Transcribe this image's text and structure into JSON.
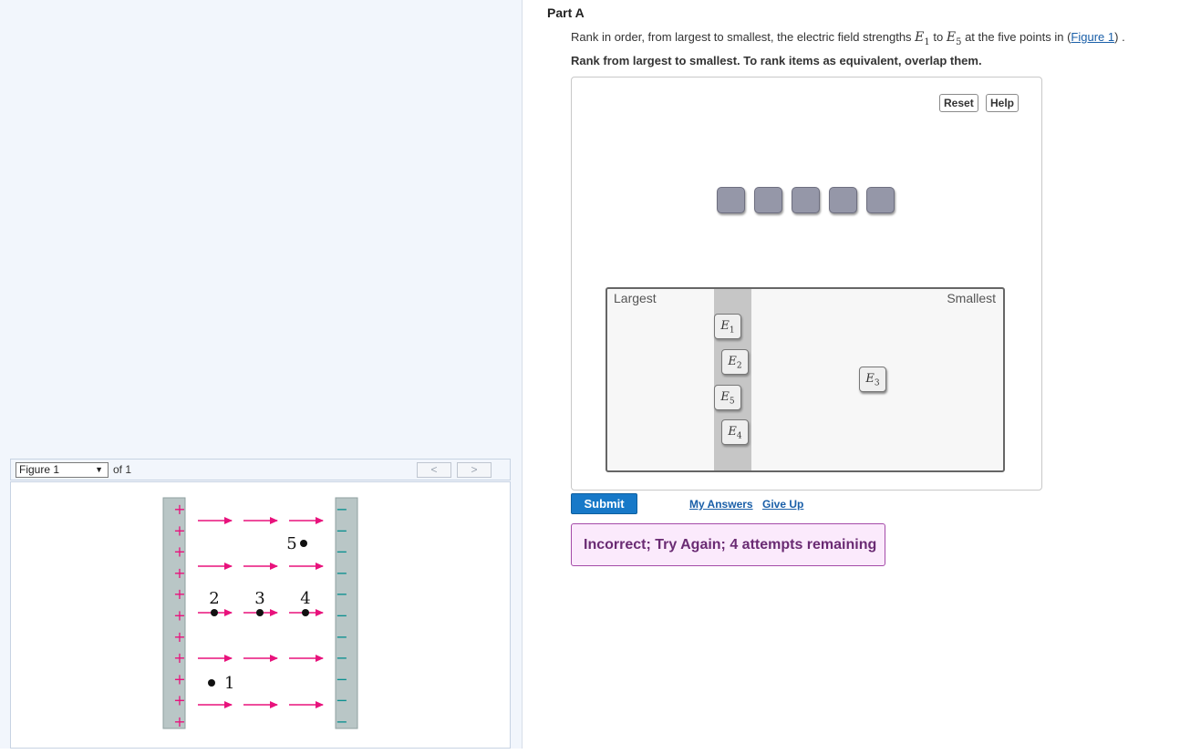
{
  "part": {
    "title": "Part A"
  },
  "question": {
    "prefix": "Rank in order, from largest to smallest, the electric field strengths ",
    "e_from": "E",
    "e_from_sub": "1",
    "mid": " to ",
    "e_to": "E",
    "e_to_sub": "5",
    "suffix": " at the five points in (",
    "figure_link": "Figure 1",
    "end": ") ."
  },
  "instruction": "Rank from largest to smallest. To rank items as equivalent, overlap them.",
  "toolbar": {
    "reset_label": "Reset",
    "help_label": "Help"
  },
  "ranking": {
    "largest_label": "Largest",
    "smallest_label": "Smallest",
    "empty_slots": 5,
    "items": [
      {
        "letter": "E",
        "sub": "1"
      },
      {
        "letter": "E",
        "sub": "2"
      },
      {
        "letter": "E",
        "sub": "5"
      },
      {
        "letter": "E",
        "sub": "4"
      },
      {
        "letter": "E",
        "sub": "3"
      }
    ]
  },
  "actions": {
    "submit_label": "Submit",
    "my_answers_label": "My Answers",
    "give_up_label": "Give Up"
  },
  "feedback": {
    "message": "Incorrect; Try Again; 4 attempts remaining"
  },
  "figure_nav": {
    "selected": "Figure 1",
    "of_label": "of 1",
    "prev_glyph": "<",
    "next_glyph": ">"
  },
  "figure": {
    "plus_sign": "+",
    "minus_sign": "−",
    "points": [
      {
        "label": "1"
      },
      {
        "label": "2"
      },
      {
        "label": "3"
      },
      {
        "label": "4"
      },
      {
        "label": "5"
      }
    ]
  },
  "colors": {
    "arrow": "#e8127c",
    "plate": "#b9c6c6",
    "submit": "#1779c8",
    "feedback_bg": "#fbeafc",
    "slot": "#9597a8"
  }
}
